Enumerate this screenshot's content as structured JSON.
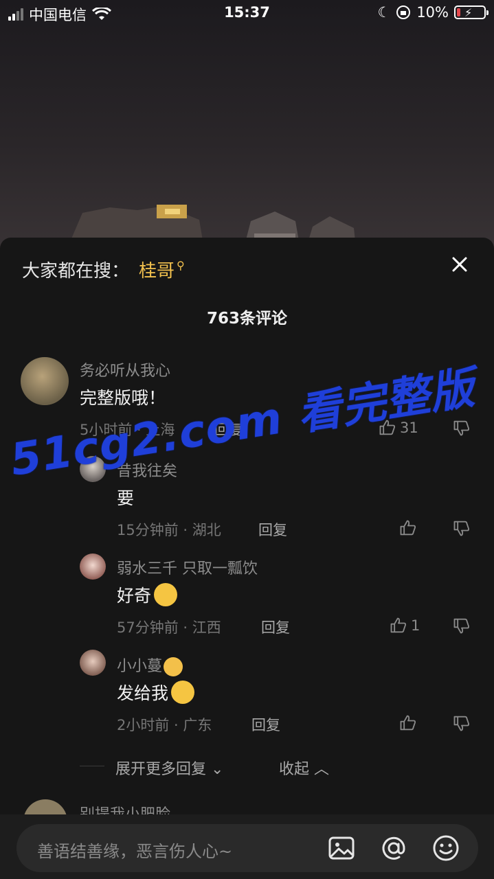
{
  "status": {
    "carrier": "中国电信",
    "time": "15:37",
    "battery": "10%"
  },
  "sheet": {
    "search_prefix": "大家都在搜：",
    "search_term": "桂哥",
    "comment_count": "763条评论",
    "comments": [
      {
        "user": "务必听从我心",
        "text": "完整版哦！",
        "meta": "5小时前 · 上海",
        "reply": "回复",
        "likes": "31"
      },
      {
        "user": "昔我往矣",
        "text": "要",
        "meta": "15分钟前 · 湖北",
        "reply": "回复",
        "likes": ""
      },
      {
        "user": "弱水三千 只取一瓢饮",
        "text": "好奇",
        "meta": "57分钟前 · 江西",
        "reply": "回复",
        "likes": "1"
      },
      {
        "user": "小小蔓",
        "text": "发给我",
        "meta": "2小时前 · 广东",
        "reply": "回复",
        "likes": ""
      }
    ],
    "expand_label": "展开更多回复",
    "collapse_label": "收起",
    "next_user": "别提我小肥脸"
  },
  "input": {
    "placeholder": "善语结善缘，恶言伤人心~"
  },
  "watermark": "51cg2.com 看完整版",
  "colors": {
    "accent": "#f2c14e",
    "sheet_bg": "#161616",
    "watermark": "#1f3fd9"
  }
}
